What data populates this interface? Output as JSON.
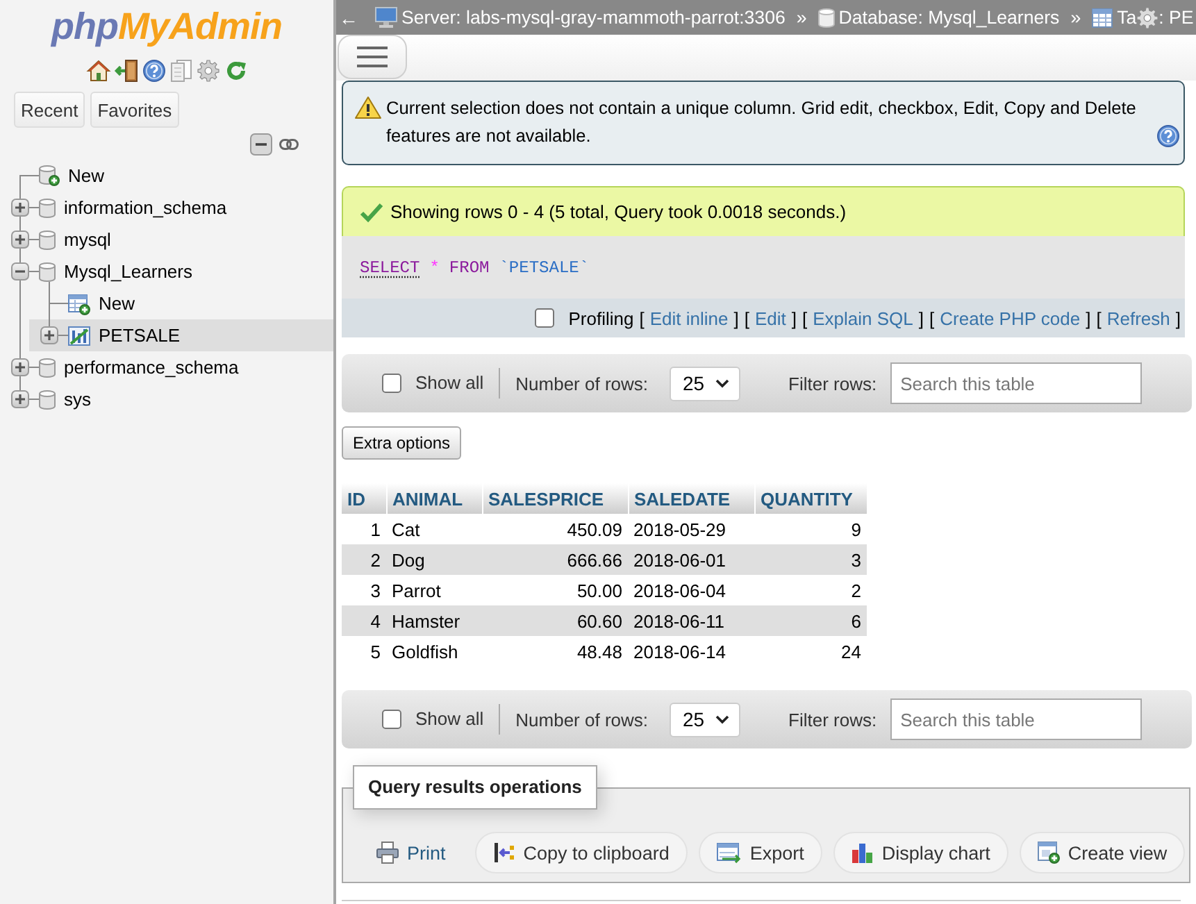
{
  "sidebar": {
    "logo": {
      "prefix": "php",
      "name": "MyAdmin"
    },
    "buttons": [
      "Recent",
      "Favorites"
    ],
    "tree": [
      {
        "kind": "new-database",
        "label": "New",
        "selected": false
      },
      {
        "kind": "database",
        "label": "information_schema",
        "expanded": false,
        "selected": false
      },
      {
        "kind": "database",
        "label": "mysql",
        "expanded": false,
        "selected": false
      },
      {
        "kind": "database",
        "label": "Mysql_Learners",
        "expanded": true,
        "selected": false,
        "children": [
          {
            "kind": "new-table",
            "label": "New",
            "selected": false
          },
          {
            "kind": "table",
            "label": "PETSALE",
            "expanded": false,
            "selected": true
          }
        ]
      },
      {
        "kind": "database",
        "label": "performance_schema",
        "expanded": false,
        "selected": false
      },
      {
        "kind": "database",
        "label": "sys",
        "expanded": false,
        "selected": false
      }
    ]
  },
  "breadcrumb": {
    "back": "←",
    "crumbs": [
      {
        "kind": "server",
        "label": "Server: labs-mysql-gray-mammoth-parrot:3306",
        "separator": "»"
      },
      {
        "kind": "database",
        "label": "Database: Mysql_Learners",
        "separator": "»"
      },
      {
        "kind": "table",
        "label": "Ta",
        "rest": ": PE"
      }
    ]
  },
  "warning": {
    "message": "Current selection does not contain a unique column. Grid edit, checkbox, Edit, Copy and Delete features are not available."
  },
  "result": {
    "message": "Showing rows 0 - 4 (5 total, Query took 0.0018 seconds.)",
    "sql": [
      {
        "kind": "keyword",
        "text": "SELECT",
        "linked": true
      },
      {
        "kind": "operator",
        "text": "*",
        "linked": false
      },
      {
        "kind": "keyword",
        "text": "FROM",
        "linked": false
      },
      {
        "kind": "identifier",
        "text": "`PETSALE`",
        "linked": false
      }
    ],
    "profiling": {
      "label": "Profiling",
      "checked": false
    },
    "actions": [
      {
        "open": "[",
        "label": "Edit inline",
        "close": "]"
      },
      {
        "open": "[",
        "label": "Edit",
        "close": "]"
      },
      {
        "open": "[",
        "label": "Explain SQL",
        "close": "]"
      },
      {
        "open": "[",
        "label": "Create PHP code",
        "close": "]"
      },
      {
        "open": "[",
        "label": "Refresh",
        "close": "]"
      }
    ]
  },
  "navigation_top": {
    "show_all": {
      "label": "Show all",
      "checked": false
    },
    "rows_label": "Number of rows:",
    "rows_value": "25",
    "filter_label": "Filter rows:",
    "filter_placeholder": "Search this table"
  },
  "extra_options": {
    "label": "Extra options"
  },
  "table": {
    "columns": [
      "ID",
      "ANIMAL",
      "SALESPRICE",
      "SALEDATE",
      "QUANTITY"
    ],
    "rows": [
      [
        "1",
        "Cat",
        "450.09",
        "2018-05-29",
        "9"
      ],
      [
        "2",
        "Dog",
        "666.66",
        "2018-06-01",
        "3"
      ],
      [
        "3",
        "Parrot",
        "50.00",
        "2018-06-04",
        "2"
      ],
      [
        "4",
        "Hamster",
        "60.60",
        "2018-06-11",
        "6"
      ],
      [
        "5",
        "Goldfish",
        "48.48",
        "2018-06-14",
        "24"
      ]
    ]
  },
  "navigation_bottom": {
    "show_all": {
      "label": "Show all",
      "checked": false
    },
    "rows_label": "Number of rows:",
    "rows_value": "25",
    "filter_label": "Filter rows:",
    "filter_placeholder": "Search this table"
  },
  "operations": {
    "title": "Query results operations",
    "actions": [
      {
        "kind": "print",
        "label": "Print"
      },
      {
        "kind": "copy",
        "label": "Copy to clipboard"
      },
      {
        "kind": "export",
        "label": "Export"
      },
      {
        "kind": "chart",
        "label": "Display chart"
      },
      {
        "kind": "create-view",
        "label": "Create view"
      }
    ]
  }
}
